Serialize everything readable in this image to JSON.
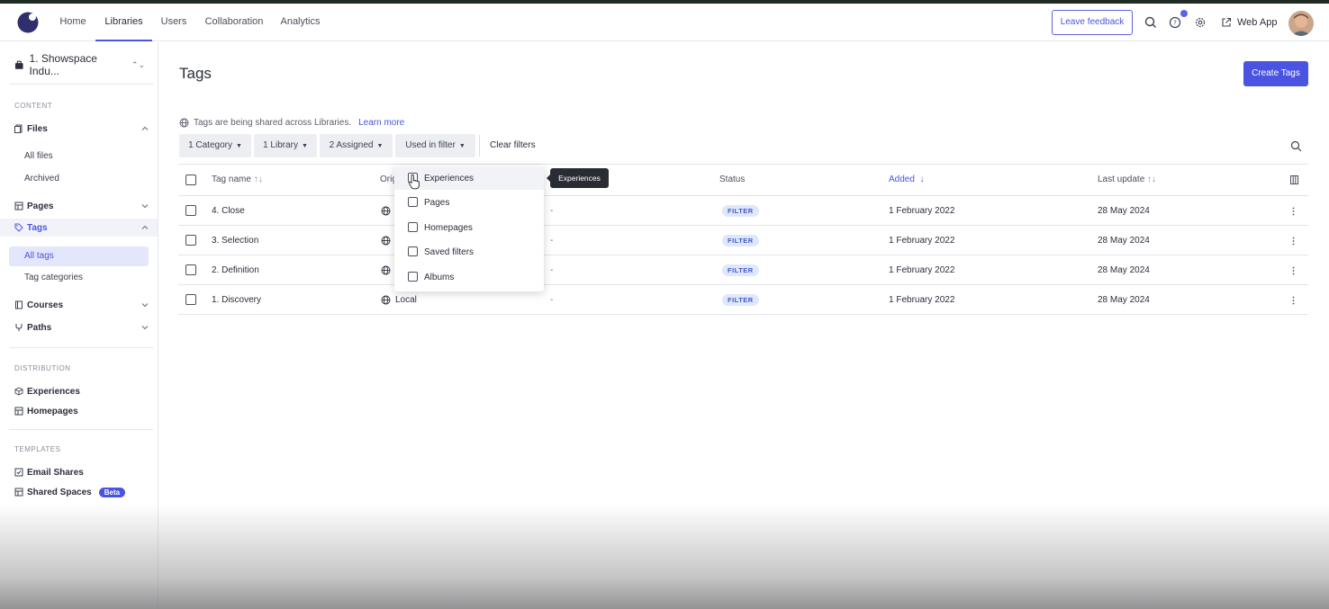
{
  "nav": {
    "tabs": [
      {
        "label": "Home"
      },
      {
        "label": "Libraries"
      },
      {
        "label": "Users"
      },
      {
        "label": "Collaboration"
      },
      {
        "label": "Analytics"
      }
    ],
    "active_tab": "Libraries",
    "feedback_label": "Leave feedback",
    "webapp_label": "Web App",
    "accent_color": "#4a54e1"
  },
  "sidebar": {
    "workspace": "1. Showspace Indu...",
    "sections": {
      "content": "CONTENT",
      "distribution": "DISTRIBUTION",
      "templates": "TEMPLATES"
    },
    "files": {
      "label": "Files",
      "children": [
        "All files",
        "Archived"
      ]
    },
    "pages": {
      "label": "Pages"
    },
    "tags": {
      "label": "Tags",
      "children": [
        "All tags",
        "Tag categories"
      ]
    },
    "courses": {
      "label": "Courses"
    },
    "paths": {
      "label": "Paths"
    },
    "experiences": {
      "label": "Experiences"
    },
    "homepages": {
      "label": "Homepages"
    },
    "email_shares": {
      "label": "Email Shares"
    },
    "shared_spaces": {
      "label": "Shared Spaces",
      "badge": "Beta"
    }
  },
  "main": {
    "title": "Tags",
    "create_button": "Create Tags",
    "share_note": "Tags are being shared across Libraries.",
    "learn_more": "Learn more",
    "filters": [
      "1 Category",
      "1 Library",
      "2 Assigned",
      "Used in filter"
    ],
    "clear_filters": "Clear filters"
  },
  "table": {
    "headers": {
      "tag_name": "Tag name",
      "origin": "Orig",
      "status": "Status",
      "added": "Added",
      "last_update": "Last update"
    },
    "rows": [
      {
        "name": "4. Close",
        "origin": "",
        "description": "-",
        "status": "FILTER",
        "added": "1 February 2022",
        "updated": "28 May 2024"
      },
      {
        "name": "3. Selection",
        "origin": "",
        "description": "-",
        "status": "FILTER",
        "added": "1 February 2022",
        "updated": "28 May 2024"
      },
      {
        "name": "2. Definition",
        "origin": "",
        "description": "-",
        "status": "FILTER",
        "added": "1 February 2022",
        "updated": "28 May 2024"
      },
      {
        "name": "1. Discovery",
        "origin": "Local",
        "description": "-",
        "status": "FILTER",
        "added": "1 February 2022",
        "updated": "28 May 2024"
      }
    ]
  },
  "dropdown": {
    "items": [
      "Experiences",
      "Pages",
      "Homepages",
      "Saved filters",
      "Albums"
    ],
    "tooltip": "Experiences"
  }
}
